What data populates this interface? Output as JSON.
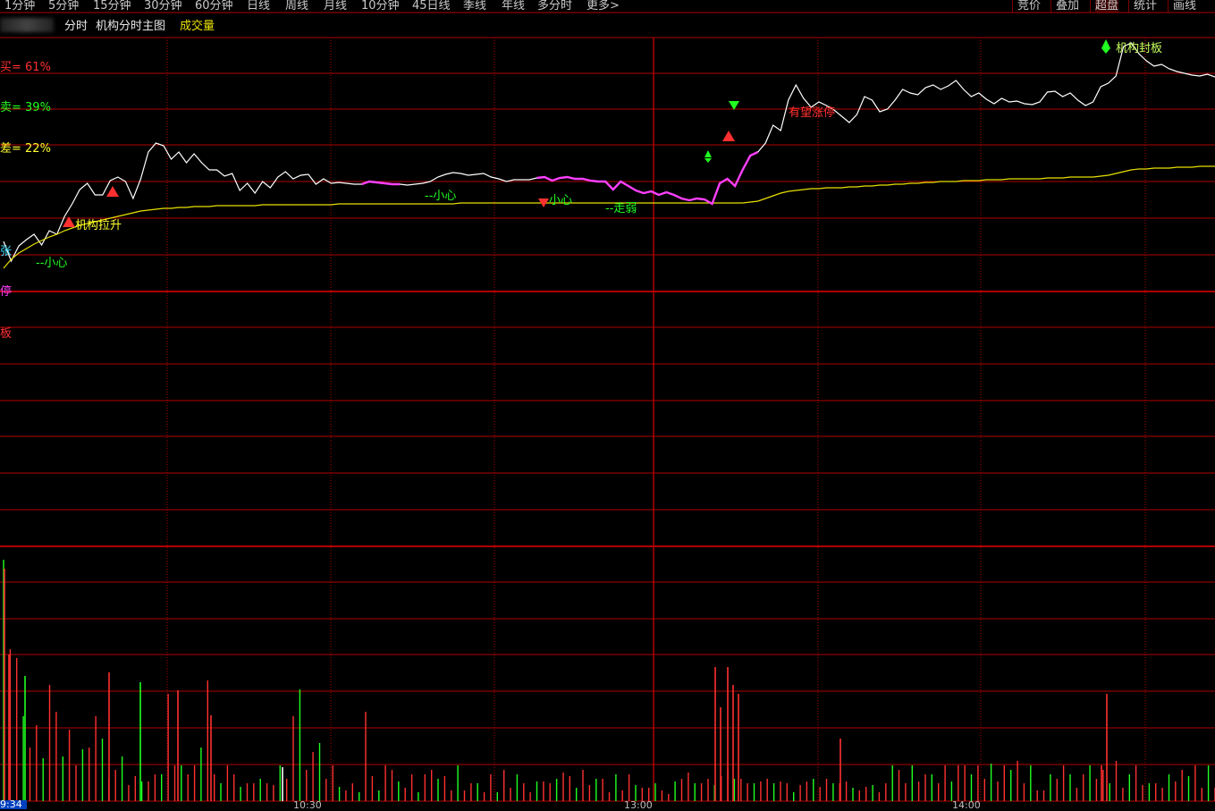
{
  "toolbar": {
    "periods": [
      "1分钟",
      "5分钟",
      "15分钟",
      "30分钟",
      "60分钟",
      "日线",
      "周线",
      "月线",
      "10分钟",
      "45日线",
      "季线",
      "年线",
      "多分时",
      "更多>"
    ],
    "right_buttons": [
      "竞价",
      "叠加",
      "超盘",
      "统计",
      "画线"
    ],
    "active_right": "超盘"
  },
  "info": {
    "mode": "分时",
    "indicator": "机构分时主图",
    "sub_indicator": "成交量"
  },
  "side_stats": {
    "buy": "买= 61%",
    "sell": "卖= 39%",
    "diff": "差= 22%",
    "side_chars": [
      "张",
      "停",
      "板"
    ]
  },
  "signals": {
    "jigou_lasheng": "机构拉升",
    "xiaoxin1": "--小心",
    "xiaoxin2": "--小心",
    "xiaoxin3": "小心",
    "zouruo": "--走弱",
    "youwang_zhangting": "有望涨停",
    "jigou_fengban": "机构封板"
  },
  "axis": {
    "time_labels": [
      "9:34",
      "10:30",
      "13:00",
      "14:00"
    ]
  },
  "colors": {
    "bg": "#000000",
    "grid": "#b00000",
    "price": "#ffffff",
    "avg": "#e8e000",
    "highlight": "#ff40ff",
    "up": "#ff3030",
    "down": "#20ff20",
    "text_yellow": "#ffff30",
    "text_green": "#20ff20",
    "text_red": "#ff3030",
    "text_magenta": "#ff40ff",
    "text_cyan": "#40e0ff"
  },
  "chart_data": {
    "type": "line",
    "price_series": [
      270,
      292,
      275,
      268,
      262,
      274,
      258,
      262,
      242,
      228,
      212,
      205,
      218,
      218,
      202,
      198,
      203,
      222,
      200,
      170,
      160,
      163,
      178,
      170,
      182,
      172,
      182,
      190,
      190,
      197,
      194,
      213,
      205,
      216,
      203,
      210,
      198,
      192,
      200,
      196,
      195,
      206,
      200,
      205,
      204,
      205,
      206,
      206,
      203,
      204,
      205,
      206,
      206,
      207,
      206,
      205,
      203,
      198,
      195,
      193,
      194,
      196,
      195,
      194,
      198,
      200,
      203,
      201,
      201,
      201,
      199,
      198,
      202,
      199,
      198,
      200,
      200,
      202,
      203,
      203,
      212,
      203,
      208,
      213,
      216,
      214,
      218,
      215,
      218,
      222,
      224,
      222,
      223,
      228,
      205,
      200,
      208,
      190,
      174,
      170,
      160,
      140,
      146,
      112,
      95,
      110,
      120,
      114,
      118,
      123,
      130,
      137,
      128,
      108,
      112,
      125,
      122,
      112,
      100,
      104,
      106,
      98,
      95,
      100,
      96,
      90,
      100,
      108,
      104,
      111,
      116,
      110,
      114,
      113,
      116,
      117,
      114,
      103,
      102,
      108,
      104,
      112,
      118,
      114,
      97,
      93,
      85,
      52,
      48,
      60,
      68,
      74,
      72,
      77,
      80,
      82,
      84,
      85,
      83,
      86
    ],
    "avg_series": [
      300,
      290,
      283,
      278,
      273,
      269,
      265,
      262,
      258,
      255,
      252,
      250,
      248,
      246,
      244,
      242,
      240,
      238,
      236,
      235,
      234,
      233,
      233,
      232,
      232,
      231,
      231,
      231,
      230,
      230,
      230,
      230,
      230,
      230,
      229,
      229,
      229,
      229,
      229,
      229,
      229,
      229,
      229,
      229,
      228,
      228,
      228,
      228,
      228,
      228,
      228,
      228,
      228,
      228,
      228,
      228,
      228,
      228,
      228,
      228,
      227,
      227,
      227,
      227,
      227,
      227,
      227,
      227,
      227,
      227,
      227,
      227,
      227,
      227,
      227,
      227,
      227,
      227,
      227,
      227,
      227,
      227,
      227,
      227,
      227,
      227,
      227,
      227,
      227,
      227,
      227,
      227,
      227,
      227,
      227,
      227,
      227,
      227,
      226,
      225,
      222,
      219,
      216,
      214,
      213,
      212,
      211,
      211,
      210,
      210,
      210,
      209,
      209,
      208,
      208,
      207,
      207,
      206,
      206,
      205,
      205,
      204,
      204,
      203,
      203,
      203,
      202,
      202,
      202,
      201,
      201,
      201,
      200,
      200,
      200,
      200,
      200,
      199,
      199,
      199,
      198,
      198,
      198,
      198,
      197,
      196,
      194,
      192,
      190,
      189,
      189,
      188,
      188,
      188,
      187,
      187,
      187,
      186,
      186,
      186
    ],
    "volume_series": [
      270,
      170,
      160,
      95,
      60,
      85,
      48,
      130,
      100,
      50,
      80,
      40,
      58,
      60,
      95,
      70,
      25,
      35,
      50,
      18,
      28,
      22,
      22,
      30,
      30,
      120,
      40,
      40,
      30,
      40,
      60,
      135,
      30,
      20,
      40,
      30,
      16,
      20,
      20,
      25,
      20,
      18,
      40,
      25,
      95,
      125,
      35,
      55,
      65,
      25,
      40,
      16,
      12,
      20,
      10,
      100,
      28,
      12,
      40,
      35,
      22,
      15,
      30,
      10,
      30,
      35,
      25,
      28,
      12,
      40,
      12,
      20,
      20,
      10,
      30,
      10,
      35,
      15,
      30,
      20,
      10,
      22,
      22,
      20,
      25,
      32,
      28,
      15,
      35,
      18,
      25,
      25,
      10,
      30,
      12,
      30,
      18,
      15,
      15,
      20,
      12,
      8,
      22,
      25,
      32,
      20,
      20,
      25,
      18,
      28,
      35,
      25,
      25,
      20,
      20,
      22,
      25,
      20,
      22,
      20,
      10,
      18,
      22,
      25,
      16,
      25,
      20,
      20,
      22,
      15,
      12,
      16,
      18,
      10,
      20,
      40,
      35,
      20,
      40,
      22,
      30,
      30,
      20,
      40,
      22,
      40,
      40,
      30,
      40,
      25,
      42,
      22,
      40,
      35,
      45,
      20,
      40,
      12,
      12,
      30,
      25,
      40,
      30,
      15,
      30,
      40,
      25,
      35,
      20,
      45,
      15,
      30,
      40,
      18,
      20,
      20,
      15,
      30,
      22,
      35,
      28,
      40,
      15,
      40,
      15
    ],
    "volume_highlight": [
      [
        800,
        150
      ],
      [
        806,
        105
      ],
      [
        814,
        150
      ],
      [
        820,
        130
      ],
      [
        826,
        120
      ],
      [
        940,
        70
      ],
      [
        1238,
        120
      ],
      [
        1232,
        40
      ]
    ],
    "x_ticks": [
      "9:34",
      "10:30",
      "13:00",
      "14:00"
    ]
  }
}
